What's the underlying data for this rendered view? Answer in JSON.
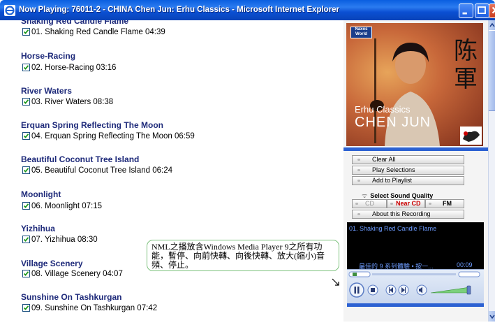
{
  "window": {
    "title": "Now Playing: 76011-2 - CHINA Chen Jun: Erhu Classics - Microsoft Internet Explorer"
  },
  "tracks": [
    {
      "title": "Shaking Red Candle Flame",
      "line": "01. Shaking Red Candle Flame  04:39",
      "checked": true
    },
    {
      "title": "Horse-Racing",
      "line": "02. Horse-Racing  03:16",
      "checked": true
    },
    {
      "title": "River Waters",
      "line": "03. River Waters  08:38",
      "checked": true
    },
    {
      "title": "Erquan Spring Reflecting The Moon",
      "line": "04. Erquan Spring Reflecting The Moon  06:59",
      "checked": true
    },
    {
      "title": "Beautiful Coconut Tree Island",
      "line": "05. Beautiful Coconut Tree Island  06:24",
      "checked": true
    },
    {
      "title": "Moonlight",
      "line": "06. Moonlight  07:15",
      "checked": true
    },
    {
      "title": "Yizhihua",
      "line": "07. Yizhihua  08:30",
      "checked": true
    },
    {
      "title": "Village Scenery",
      "line": "08. Village Scenery  04:07",
      "checked": true
    },
    {
      "title": "Sunshine On Tashkurgan",
      "line": "09. Sunshine On Tashkurgan  07:42",
      "checked": true
    }
  ],
  "tooltip": {
    "text": "NML之播放含Windows Media Player 9之所有功能，暫停、向前快轉、向後快轉、放大(縮小)音頻、停止。"
  },
  "cover": {
    "brand": "Naxos World",
    "subtitle": "Erhu Classics",
    "artist": "CHEN JUN",
    "calligraphy": "陈軍"
  },
  "player": {
    "buttons": {
      "clear_all": "Clear All",
      "play_selections": "Play Selections",
      "add_to_playlist": "Add to Playlist",
      "about": "About this Recording"
    },
    "quality": {
      "label": "Select Sound Quality",
      "options": [
        "CD",
        "Near CD",
        "FM"
      ],
      "selected": "Near CD"
    },
    "media": {
      "now_playing": "01. Shaking Red Candle Flame",
      "ticker": "最佳的 9 系列體驗 • 按一...",
      "elapsed": "00:09"
    },
    "volume_level": 0.95
  },
  "colors": {
    "track_title": "#1e2a7a",
    "near_cd": "#cc0000",
    "media_text": "#6c9bff",
    "titlebar": "#0b4fd2"
  }
}
